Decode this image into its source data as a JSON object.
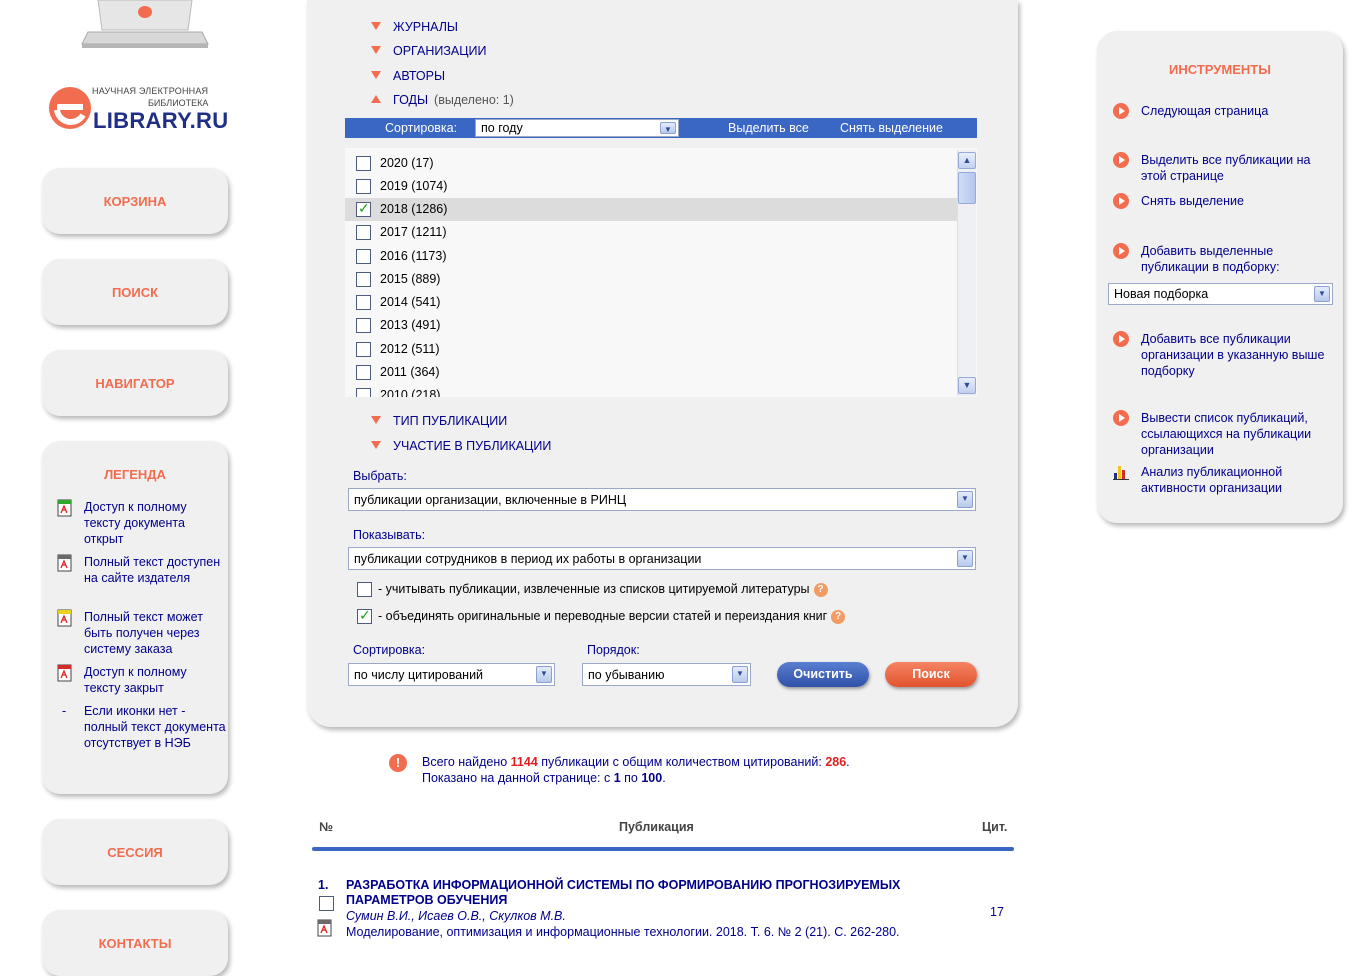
{
  "logo": {
    "line1": "НАУЧНАЯ ЭЛЕКТРОННАЯ",
    "line2": "БИБЛИОТЕКА",
    "wordmark": "LIBRARY.RU",
    "accent_color": "#f26c4f",
    "brand_color": "#1f2f86"
  },
  "sidebar": {
    "cart": "КОРЗИНА",
    "search": "ПОИСК",
    "navigator": "НАВИГАТОР",
    "session": "СЕССИЯ",
    "contacts": "КОНТАКТЫ"
  },
  "legend": {
    "title": "ЛЕГЕНДА",
    "items": [
      {
        "icon": "pdf-open-access-icon",
        "text": "Доступ к полному тексту документа открыт"
      },
      {
        "icon": "pdf-publisher-site-icon",
        "text": "Полный текст доступен на сайте издателя"
      },
      {
        "icon": "pdf-order-icon",
        "text": "Полный текст может быть получен через систему заказа"
      },
      {
        "icon": "pdf-closed-icon",
        "text": "Доступ к полному тексту закрыт"
      },
      {
        "icon": "dash",
        "text": "Если иконки нет - полный текст документа отсутствует в НЭБ"
      }
    ],
    "dash": "-"
  },
  "filters": {
    "journals": "ЖУРНАЛЫ",
    "organizations": "ОРГАНИЗАЦИИ",
    "authors": "АВТОРЫ",
    "years": "ГОДЫ",
    "years_selected": "(выделено: 1)",
    "pub_type": "ТИП ПУБЛИКАЦИИ",
    "participation": "УЧАСТИЕ В ПУБЛИКАЦИИ"
  },
  "years_bar": {
    "sort_label": "Сортировка:",
    "sort_value": "по году",
    "select_all": "Выделить все",
    "deselect": "Снять выделение"
  },
  "years": [
    {
      "label": "2020  (17)",
      "checked": false
    },
    {
      "label": "2019  (1074)",
      "checked": false
    },
    {
      "label": "2018  (1286)",
      "checked": true
    },
    {
      "label": "2017  (1211)",
      "checked": false
    },
    {
      "label": "2016  (1173)",
      "checked": false
    },
    {
      "label": "2015  (889)",
      "checked": false
    },
    {
      "label": "2014  (541)",
      "checked": false
    },
    {
      "label": "2013  (491)",
      "checked": false
    },
    {
      "label": "2012  (511)",
      "checked": false
    },
    {
      "label": "2011  (364)",
      "checked": false
    },
    {
      "label": "2010  (218)",
      "checked": false
    }
  ],
  "form": {
    "choose_label": "Выбрать:",
    "choose_value": "публикации организации, включенные в РИНЦ",
    "show_label": "Показывать:",
    "show_value": "публикации сотрудников в период их работы в организации",
    "opt1": "- учитывать публикации, извлеченные из списков цитируемой литературы",
    "opt2": "- объединять оригинальные и переводные версии статей и переиздания книг",
    "help": "?",
    "sort_label": "Сортировка:",
    "sort_value": "по числу цитирований",
    "order_label": "Порядок:",
    "order_value": "по убыванию",
    "clear_btn": "Очистить",
    "search_btn": "Поиск"
  },
  "results": {
    "info_icon": "!",
    "found_prefix": "Всего найдено ",
    "found_count": "1144",
    "found_mid": " публикации с общим количеством цитирований: ",
    "found_cit": "286",
    "found_end": ".",
    "shown_prefix": "Показано на данной странице: с ",
    "shown_from": "1",
    "shown_mid": " по ",
    "shown_to": "100",
    "shown_end": ".",
    "col_num": "№",
    "col_pub": "Публикация",
    "col_cit": "Цит.",
    "items": [
      {
        "num": "1.",
        "title": "РАЗРАБОТКА ИНФОРМАЦИОННОЙ СИСТЕМЫ ПО ФОРМИРОВАНИЮ ПРОГНОЗИРУЕМЫХ ПАРАМЕТРОВ ОБУЧЕНИЯ",
        "authors": "Сумин В.И., Исаев О.В., Скулков М.В.",
        "source": "Моделирование, оптимизация и информационные технологии. 2018. Т. 6. № 2 (21). С. 262-280.",
        "citations": "17"
      }
    ]
  },
  "tools": {
    "title": "ИНСТРУМЕНТЫ",
    "next_page": "Следующая страница",
    "select_all_page": "Выделить все публикации на этой странице",
    "deselect": "Снять выделение",
    "add_selected": "Добавить выделенные публикации в подборку:",
    "collection_value": "Новая подборка",
    "add_all": "Добавить все публикации организации в указанную выше подборку",
    "citing_list": "Вывести список публикаций, ссылающихся на публикации организации",
    "analysis": "Анализ публикационной активности организации"
  }
}
